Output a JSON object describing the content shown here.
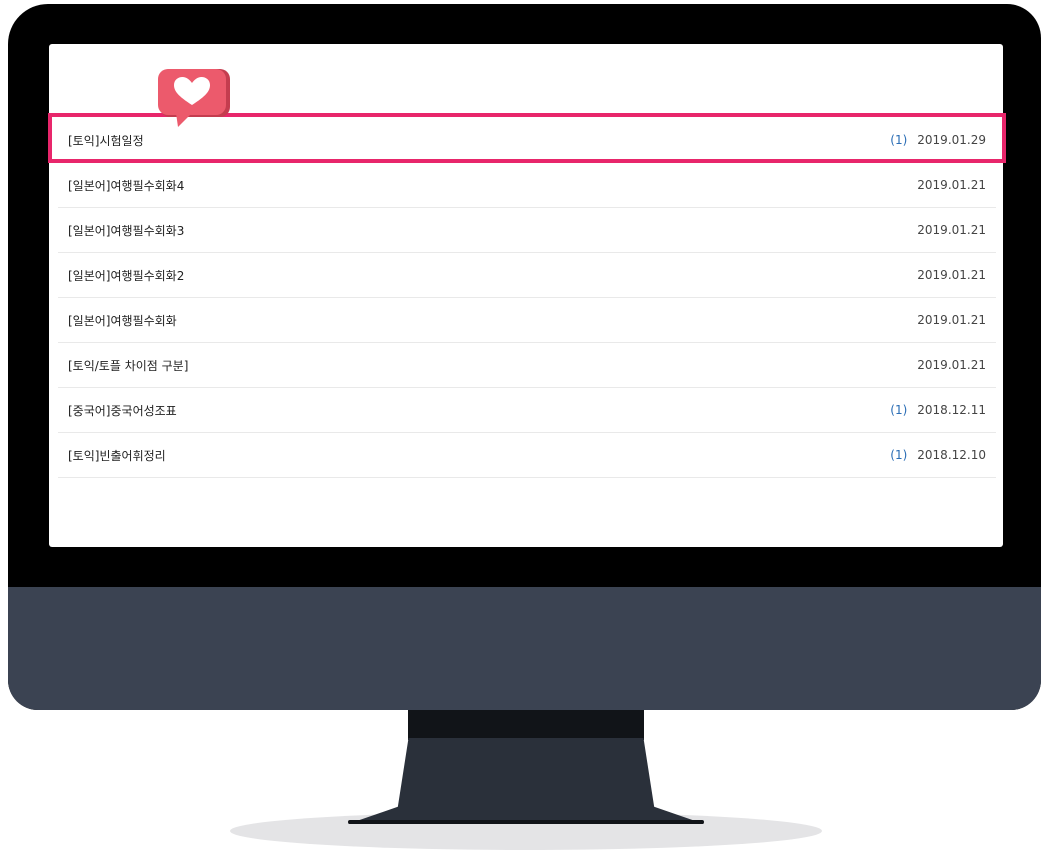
{
  "posts": [
    {
      "title": "[토익]시험일정",
      "comments": "(1)",
      "date": "2019.01.29"
    },
    {
      "title": "[일본어]여행필수회화4",
      "comments": "",
      "date": "2019.01.21"
    },
    {
      "title": "[일본어]여행필수회화3",
      "comments": "",
      "date": "2019.01.21"
    },
    {
      "title": "[일본어]여행필수회화2",
      "comments": "",
      "date": "2019.01.21"
    },
    {
      "title": "[일본어]여행필수회화",
      "comments": "",
      "date": "2019.01.21"
    },
    {
      "title": "[토익/토플 차이점 구분]",
      "comments": "",
      "date": "2019.01.21"
    },
    {
      "title": "[중국어]중국어성조표",
      "comments": "(1)",
      "date": "2018.12.11"
    },
    {
      "title": "[토익]빈출어휘정리",
      "comments": "(1)",
      "date": "2018.12.10"
    }
  ],
  "colors": {
    "highlight": "#e8266b",
    "heart_badge": "#ec5a6c",
    "comment_count": "#2a6db5",
    "monitor_chin": "#3b4352"
  },
  "icons": {
    "badge": "heart-speech-bubble-icon"
  }
}
